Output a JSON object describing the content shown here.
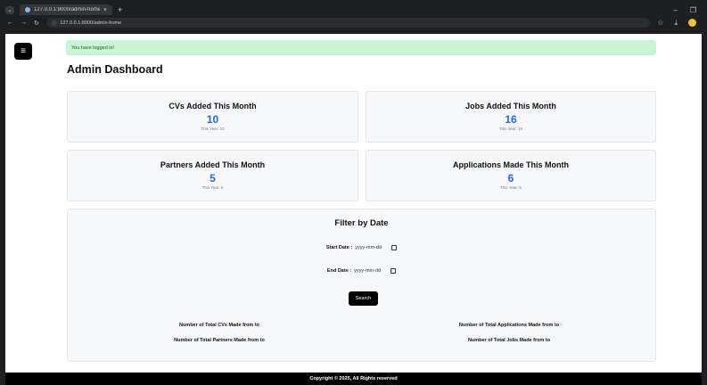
{
  "browser": {
    "tab_title": "127.0.0.1:8000/admin-home",
    "address": "127.0.0.1:8000/admin-home",
    "new_tab": "+",
    "tab_close": "×"
  },
  "page": {
    "menu_icon": "≡",
    "alert": "You have logged in!",
    "title": "Admin Dashboard",
    "cards": [
      {
        "title": "CVs Added This Month",
        "value": "10",
        "sub": "This Year: 10"
      },
      {
        "title": "Jobs Added This Month",
        "value": "16",
        "sub": "This Year: 16"
      },
      {
        "title": "Partners Added This Month",
        "value": "5",
        "sub": "This Year: 5"
      },
      {
        "title": "Applications Made This Month",
        "value": "6",
        "sub": "This Year: 6"
      }
    ],
    "filter": {
      "title": "Filter by Date",
      "start_label": "Start Date :",
      "start_placeholder": "yyyy-mm-dd",
      "end_label": "End Date :",
      "end_placeholder": "yyyy-mm-dd",
      "search_label": "Search",
      "stats": [
        "Number of Total CVs Made from to",
        "Number of Total Applications Made from to",
        "Number of Total Partners Made from to",
        "Number of Total Jobs Made from to"
      ]
    },
    "footer": "Copyright © 2025, All Rights reserved"
  }
}
